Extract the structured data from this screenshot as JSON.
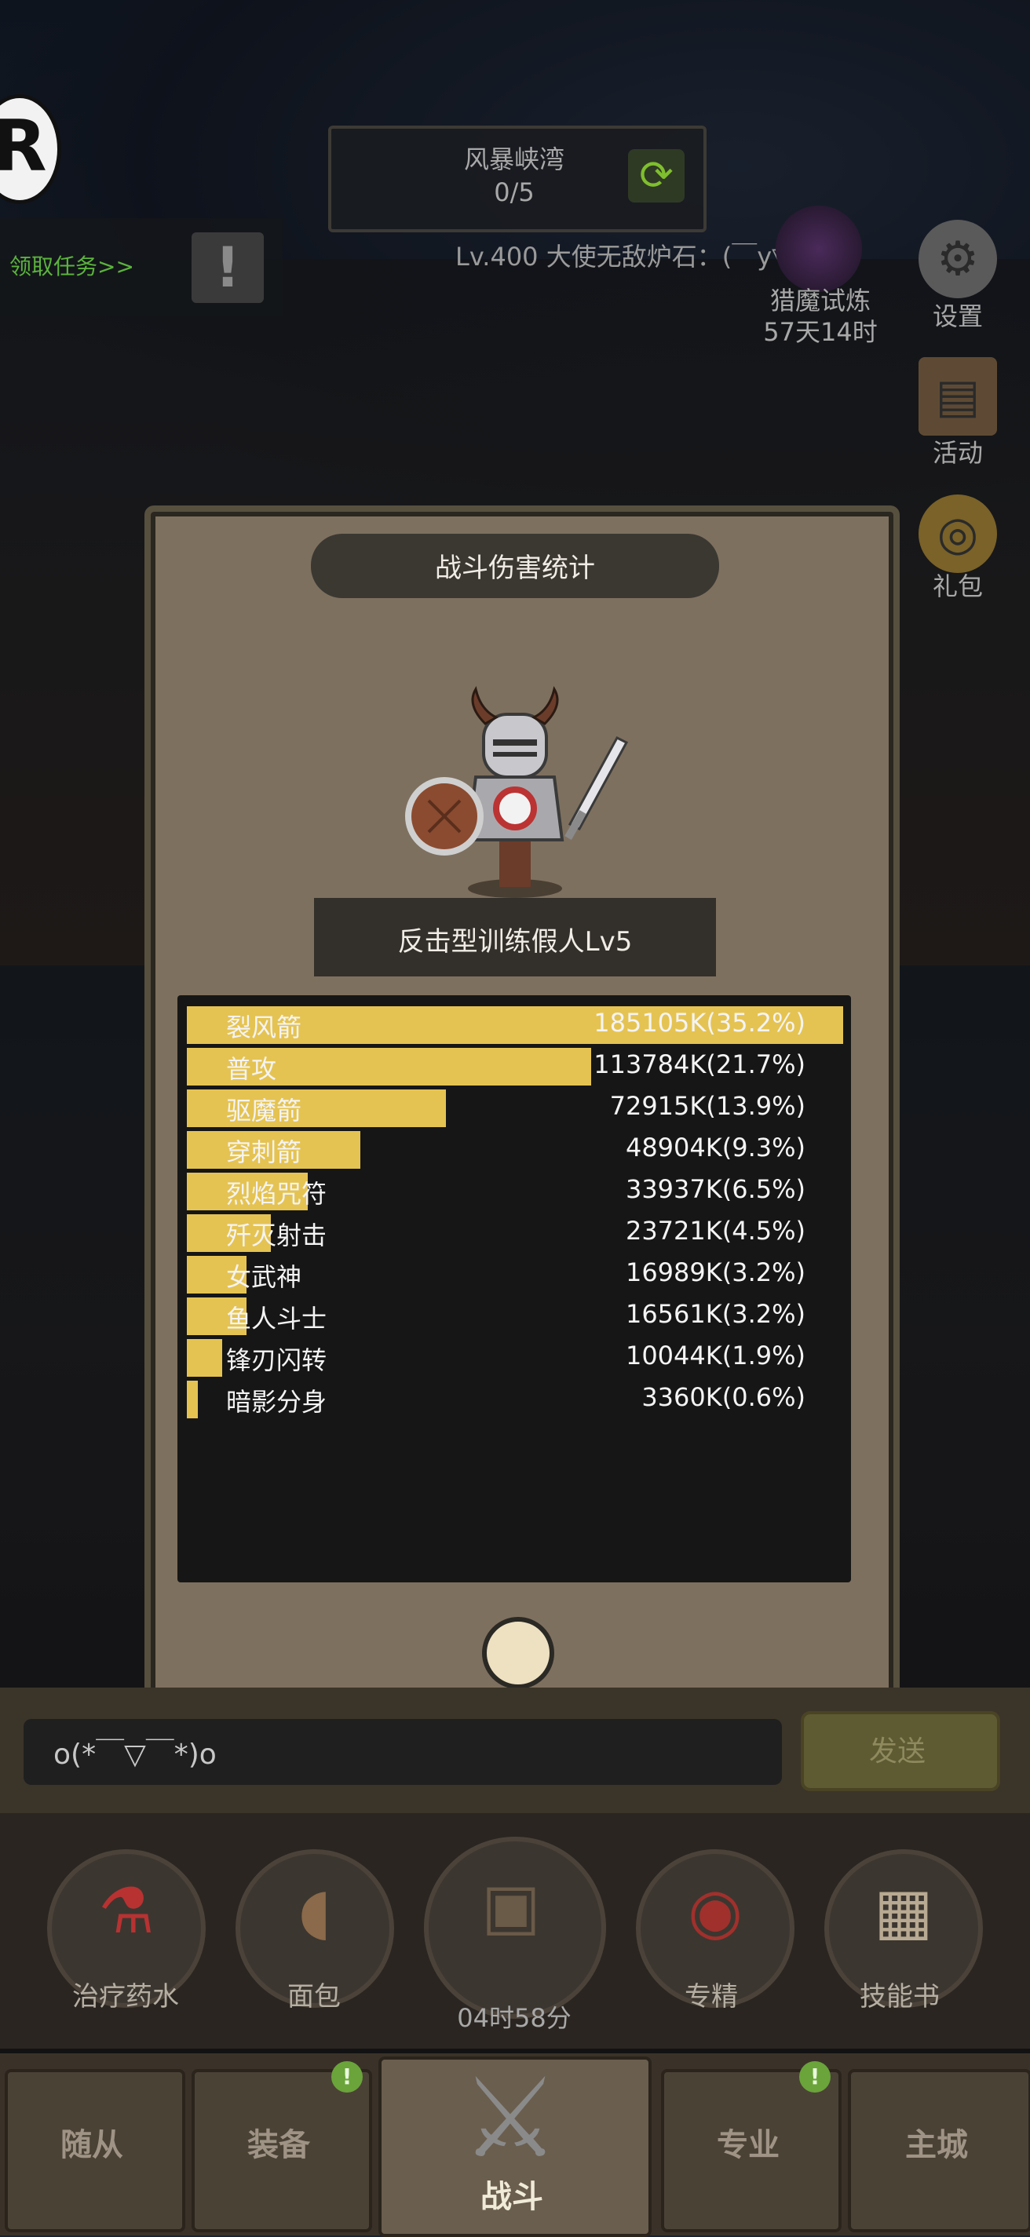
{
  "hud": {
    "logo_letter": "R",
    "quest_text": "领取任务>>",
    "quest_icon": "!",
    "region_name": "风暴峡湾",
    "region_progress": "0/5",
    "player_line": "Lv.400 大使无敌炉石：(￣y▽￣)╭",
    "hunt_label": "猎魔试炼",
    "hunt_time": "57天14时",
    "settings_label": "设置",
    "activity_label": "活动",
    "gift_label": "礼包"
  },
  "modal": {
    "title": "战斗伤害统计",
    "target": "反击型训练假人Lv5",
    "rows": [
      {
        "skill": "裂风箭",
        "damage": "185105K(35.2%)",
        "percent": 35.2
      },
      {
        "skill": "普攻",
        "damage": "113784K(21.7%)",
        "percent": 21.7
      },
      {
        "skill": "驱魔箭",
        "damage": "72915K(13.9%)",
        "percent": 13.9
      },
      {
        "skill": "穿刺箭",
        "damage": "48904K(9.3%)",
        "percent": 9.3
      },
      {
        "skill": "烈焰咒符",
        "damage": "33937K(6.5%)",
        "percent": 6.5
      },
      {
        "skill": "歼灭射击",
        "damage": "23721K(4.5%)",
        "percent": 4.5
      },
      {
        "skill": "女武神",
        "damage": "16989K(3.2%)",
        "percent": 3.2
      },
      {
        "skill": "鱼人斗士",
        "damage": "16561K(3.2%)",
        "percent": 3.2
      },
      {
        "skill": "锋刃闪转",
        "damage": "10044K(1.9%)",
        "percent": 1.9
      },
      {
        "skill": "暗影分身",
        "damage": "3360K(0.6%)",
        "percent": 0.6
      }
    ]
  },
  "chat": {
    "text": "o(*￣▽￣*)o",
    "send_label": "发送"
  },
  "items": {
    "potion_label": "治疗药水",
    "bread_label": "面包",
    "chest_time": "04时58分",
    "specialize_label": "专精",
    "skillbook_label": "技能书"
  },
  "nav": {
    "follower_label": "随从",
    "equipment_label": "装备",
    "battle_label": "战斗",
    "profession_label": "专业",
    "city_label": "主城",
    "badge_text": "!"
  }
}
